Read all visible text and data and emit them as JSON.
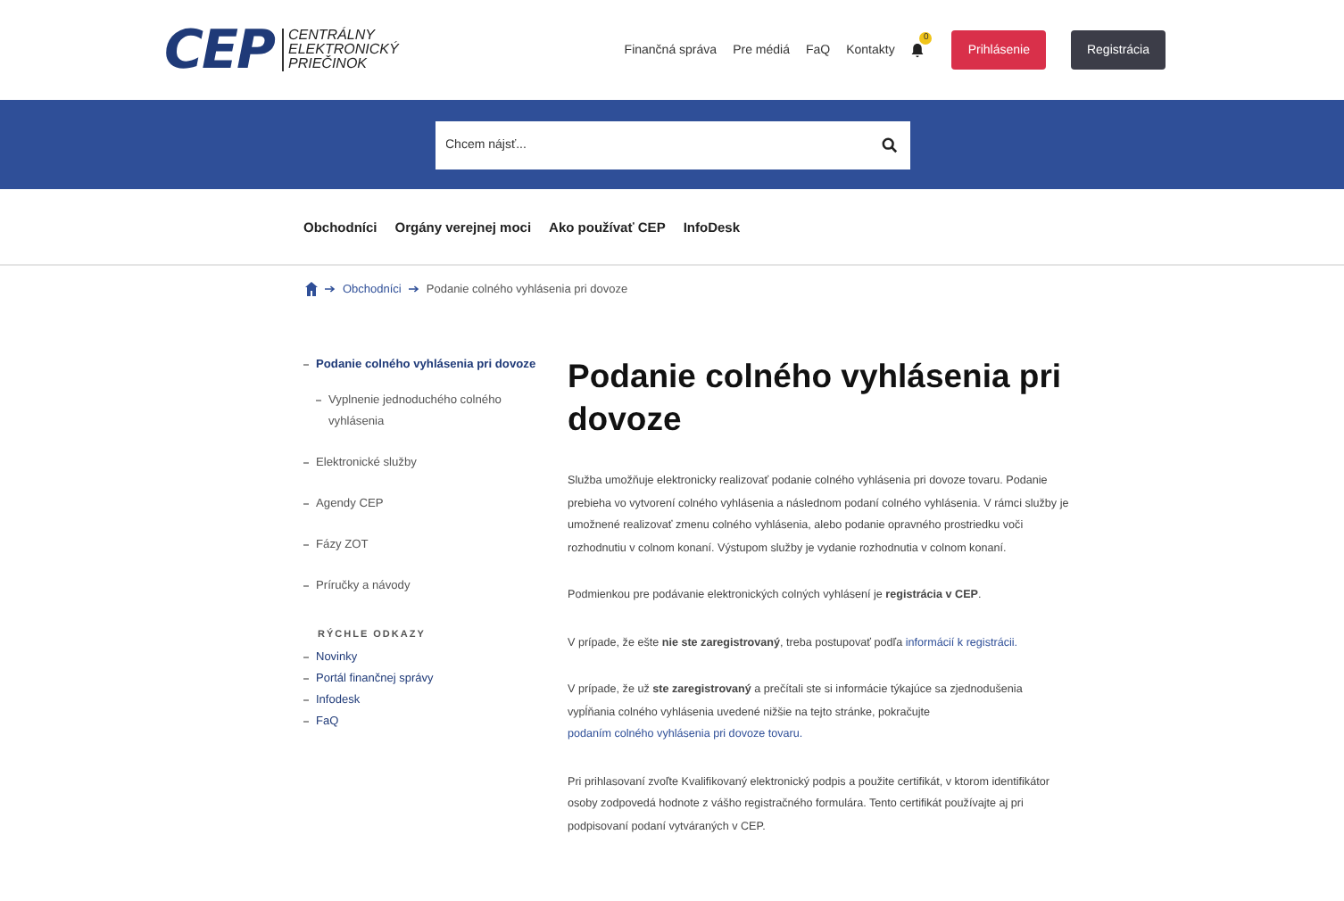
{
  "logo": {
    "mark": "CEP",
    "lines": [
      "CENTRÁLNY",
      "ELEKTRONICKÝ",
      "PRIEČINOK"
    ]
  },
  "top_links": [
    "Finančná správa",
    "Pre médiá",
    "FaQ",
    "Kontakty"
  ],
  "notifications": {
    "count": "0"
  },
  "buttons": [
    {
      "label": "Prihlásenie",
      "kind": "primary"
    },
    {
      "label": "Registrácia",
      "kind": "secondary"
    }
  ],
  "search": {
    "placeholder": "Chcem nájsť..."
  },
  "main_nav": [
    "Obchodníci",
    "Orgány verejnej moci",
    "Ako používať CEP",
    "InfoDesk"
  ],
  "breadcrumb": [
    "Obchodníci",
    "Podanie colného vyhlásenia pri dovoze"
  ],
  "sidebar": {
    "items": [
      {
        "label": "Podanie colného vyhlásenia pri dovoze",
        "selected": true,
        "children": [
          {
            "label": "Vyplnenie jednoduchého colného vyhlásenia",
            "selected": false
          }
        ]
      },
      {
        "label": "Elektronické služby",
        "selected": false
      },
      {
        "label": "Agendy CEP",
        "selected": false
      },
      {
        "label": "Fázy ZOT",
        "selected": false
      },
      {
        "label": "Príručky a návody",
        "selected": false
      }
    ],
    "quick_links_title": "RÝCHLE ODKAZY",
    "quick_links": [
      "Novinky",
      "Portál finančnej správy",
      "Infodesk",
      "FaQ"
    ]
  },
  "article": {
    "title": "Podanie colného vyhlásenia pri dovoze",
    "paragraphs": [
      [
        {
          "kind": "text",
          "text": "Služba umožňuje elektronicky realizovať podanie colného vyhlásenia pri dovoze tovaru. Podanie prebieha vo vytvorení colného vyhlásenia a následnom podaní colného vyhlásenia. V rámci služby je umožnené realizovať zmenu colného vyhlásenia, alebo podanie opravného prostriedku voči rozhodnutiu v colnom konaní. Výstupom služby je vydanie rozhodnutia v colnom konaní."
        }
      ],
      [
        {
          "kind": "text",
          "text": "Podmienkou pre podávanie elektronických colných vyhlásení je **registrácia v CEP**."
        }
      ],
      [
        {
          "kind": "text",
          "text": "V prípade, že ešte **nie ste zaregistrovaný**, treba postupovať podľa"
        },
        {
          "kind": "link",
          "text": "informácií k registrácii."
        }
      ],
      [
        {
          "kind": "text",
          "text": "V prípade, že už **ste zaregistrovaný** a prečítali ste si informácie týkajúce sa zjednodušenia vypĺňania colného vyhlásenia uvedené nižšie na tejto stránke, pokračujte"
        },
        {
          "kind": "link",
          "text": "podaním colného vyhlásenia pri dovoze tovaru."
        }
      ],
      [
        {
          "kind": "text",
          "text": "Pri prihlasovaní zvoľte Kvalifikovaný elektronický podpis a použite certifikát, v ktorom identifikátor osoby zodpovedá hodnote z vášho registračného formulára. Tento certifikát používajte aj pri podpisovaní podaní vytváraných v CEP."
        }
      ]
    ]
  }
}
